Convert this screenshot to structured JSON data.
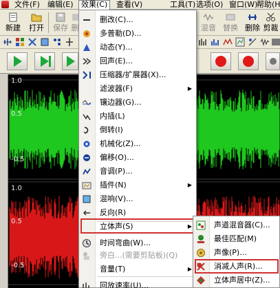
{
  "menubar": {
    "items": [
      "文件(F)",
      "编辑(E)",
      "效果(C)",
      "查看(V)",
      "工具(T)",
      "选项(O)",
      "窗口(W)",
      "帮助(H)"
    ]
  },
  "toolbar": {
    "new_label": "新建",
    "open_label": "打开",
    "save_label": "保存",
    "delete_label": "删",
    "mix_label": "混音",
    "swap_label": "替换",
    "remove_label": "删除",
    "cut_label": "剪裁"
  },
  "waveform": {
    "top_channel": {
      "labels": [
        "1.0",
        "0.5",
        "-0.5"
      ],
      "color": "#1ec81e"
    },
    "bottom_channel": {
      "labels": [
        "1.0",
        "0.5",
        "-0.5"
      ],
      "color": "#d81818"
    },
    "background": "#000000"
  },
  "effects_menu": {
    "items": [
      {
        "label": "删改(C)...",
        "icon": "dash-icon",
        "has_submenu": false,
        "disabled": false
      },
      {
        "label": "多普勒(D)...",
        "icon": "doppler-icon",
        "has_submenu": false,
        "disabled": false
      },
      {
        "label": "动态(Y)...",
        "icon": "dynamics-icon",
        "has_submenu": false,
        "disabled": false
      },
      {
        "label": "回声(E)...",
        "icon": "echo-icon",
        "has_submenu": false,
        "disabled": false
      },
      {
        "label": "压缩器/扩展器(X)...",
        "icon": "compressor-icon",
        "has_submenu": false,
        "disabled": false
      },
      {
        "label": "滤波器(F)",
        "icon": "",
        "has_submenu": true,
        "disabled": false
      },
      {
        "label": "镶边器(G)...",
        "icon": "flanger-icon",
        "has_submenu": false,
        "disabled": false
      },
      {
        "label": "内插(L)",
        "icon": "interpolate-icon",
        "has_submenu": false,
        "disabled": false
      },
      {
        "label": "倒转(I)",
        "icon": "invert-icon",
        "has_submenu": false,
        "disabled": false
      },
      {
        "label": "机械化(Z)...",
        "icon": "mechanize-icon",
        "has_submenu": false,
        "disabled": false
      },
      {
        "label": "偏移(O)...",
        "icon": "offset-icon",
        "has_submenu": false,
        "disabled": false
      },
      {
        "label": "音调(P)...",
        "icon": "pitch-icon",
        "has_submenu": false,
        "disabled": false
      },
      {
        "label": "插件(N)",
        "icon": "plugin-icon",
        "has_submenu": true,
        "disabled": false
      },
      {
        "label": "混响(V)...",
        "icon": "reverb-icon",
        "has_submenu": false,
        "disabled": false
      },
      {
        "label": "反向(R)",
        "icon": "reverse-icon",
        "has_submenu": false,
        "disabled": false
      },
      {
        "label": "立体声(S)",
        "icon": "",
        "has_submenu": true,
        "disabled": false
      },
      {
        "label": "时间弯曲(W)...",
        "icon": "timewarp-icon",
        "has_submenu": false,
        "disabled": false
      },
      {
        "label": "旁白...(需要剪贴板)(Q)",
        "icon": "voiceover-icon",
        "has_submenu": false,
        "disabled": true
      },
      {
        "label": "音量(T)",
        "icon": "",
        "has_submenu": true,
        "disabled": false
      },
      {
        "label": "回放速率(U)...",
        "icon": "playback-rate-icon",
        "has_submenu": false,
        "disabled": false
      }
    ]
  },
  "stereo_menu": {
    "items": [
      {
        "label": "声道混音器(C)...",
        "icon": "channel-mixer-icon"
      },
      {
        "label": "最佳匹配(M)",
        "icon": "best-match-icon"
      },
      {
        "label": "声像(P)...",
        "icon": "pan-icon"
      },
      {
        "label": "消减人声(R)...",
        "icon": "vocal-remover-icon"
      },
      {
        "label": "立体声居中(Z)...",
        "icon": "stereo-center-icon"
      }
    ]
  },
  "colors": {
    "highlight_box": "#d03030",
    "play_green": "#1fa83a",
    "record_red": "#e01818"
  }
}
